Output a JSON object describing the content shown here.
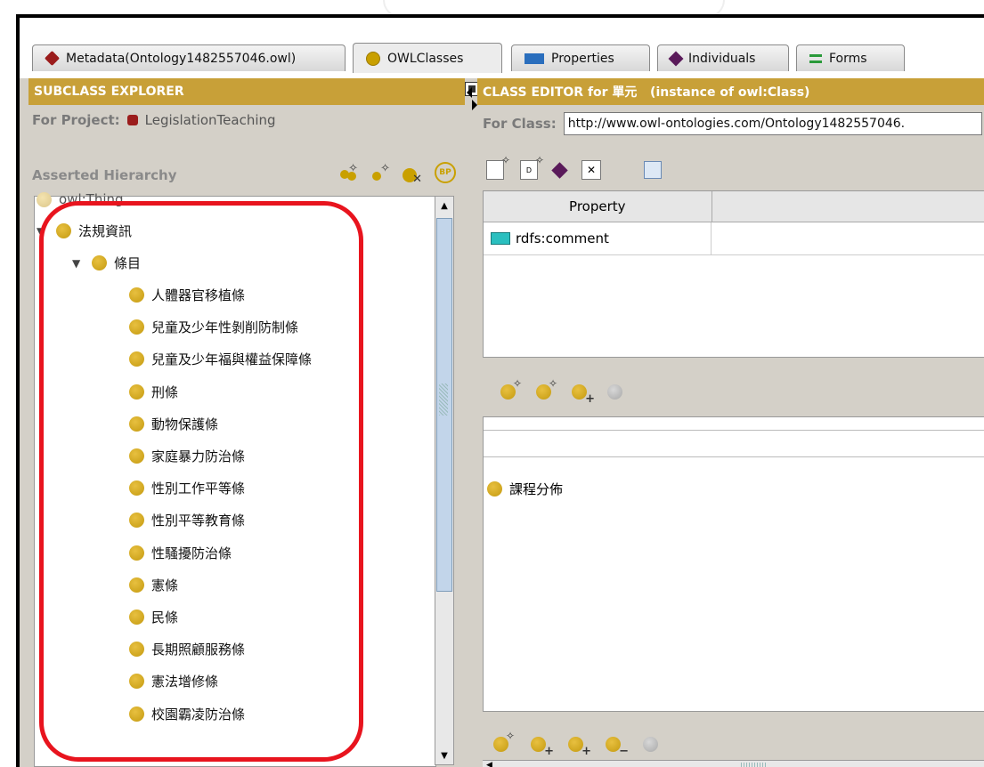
{
  "tabs": [
    {
      "label": "Metadata(Ontology1482557046.owl)",
      "icon": "ontology-hex-icon"
    },
    {
      "label": "OWLClasses",
      "icon": "class-circle-icon"
    },
    {
      "label": "Properties",
      "icon": "property-rect-icon"
    },
    {
      "label": "Individuals",
      "icon": "individual-diamond-icon"
    },
    {
      "label": "Forms",
      "icon": "forms-icon"
    }
  ],
  "subclass_explorer": {
    "title": "SUBCLASS EXPLORER",
    "project_label": "For Project:",
    "project_name": "LegislationTeaching",
    "hierarchy_label": "Asserted Hierarchy",
    "tree": {
      "root": "owl:Thing",
      "level1": "法規資訊",
      "level2": "條目",
      "children": [
        "人體器官移植條",
        "兒童及少年性剝削防制條",
        "兒童及少年福與權益保障條",
        "刑條",
        "動物保護條",
        "家庭暴力防治條",
        "性別工作平等條",
        "性別平等教育條",
        "性騷擾防治條",
        "憲條",
        "民條",
        "長期照顧服務條",
        "憲法增修條",
        "校園霸凌防治條"
      ]
    }
  },
  "class_editor": {
    "title": "CLASS EDITOR for 單元   (instance of owl:Class)",
    "for_class_label": "For Class:",
    "for_class_value": "http://www.owl-ontologies.com/Ontology1482557046.",
    "property_header": "Property",
    "properties": [
      {
        "name": "rdfs:comment",
        "value": ""
      }
    ],
    "superclasses": [
      "課程分佈"
    ]
  },
  "colors": {
    "header_gold": "#c8a038",
    "highlight_red": "#e8141e",
    "class_ball": "#c9a000"
  }
}
